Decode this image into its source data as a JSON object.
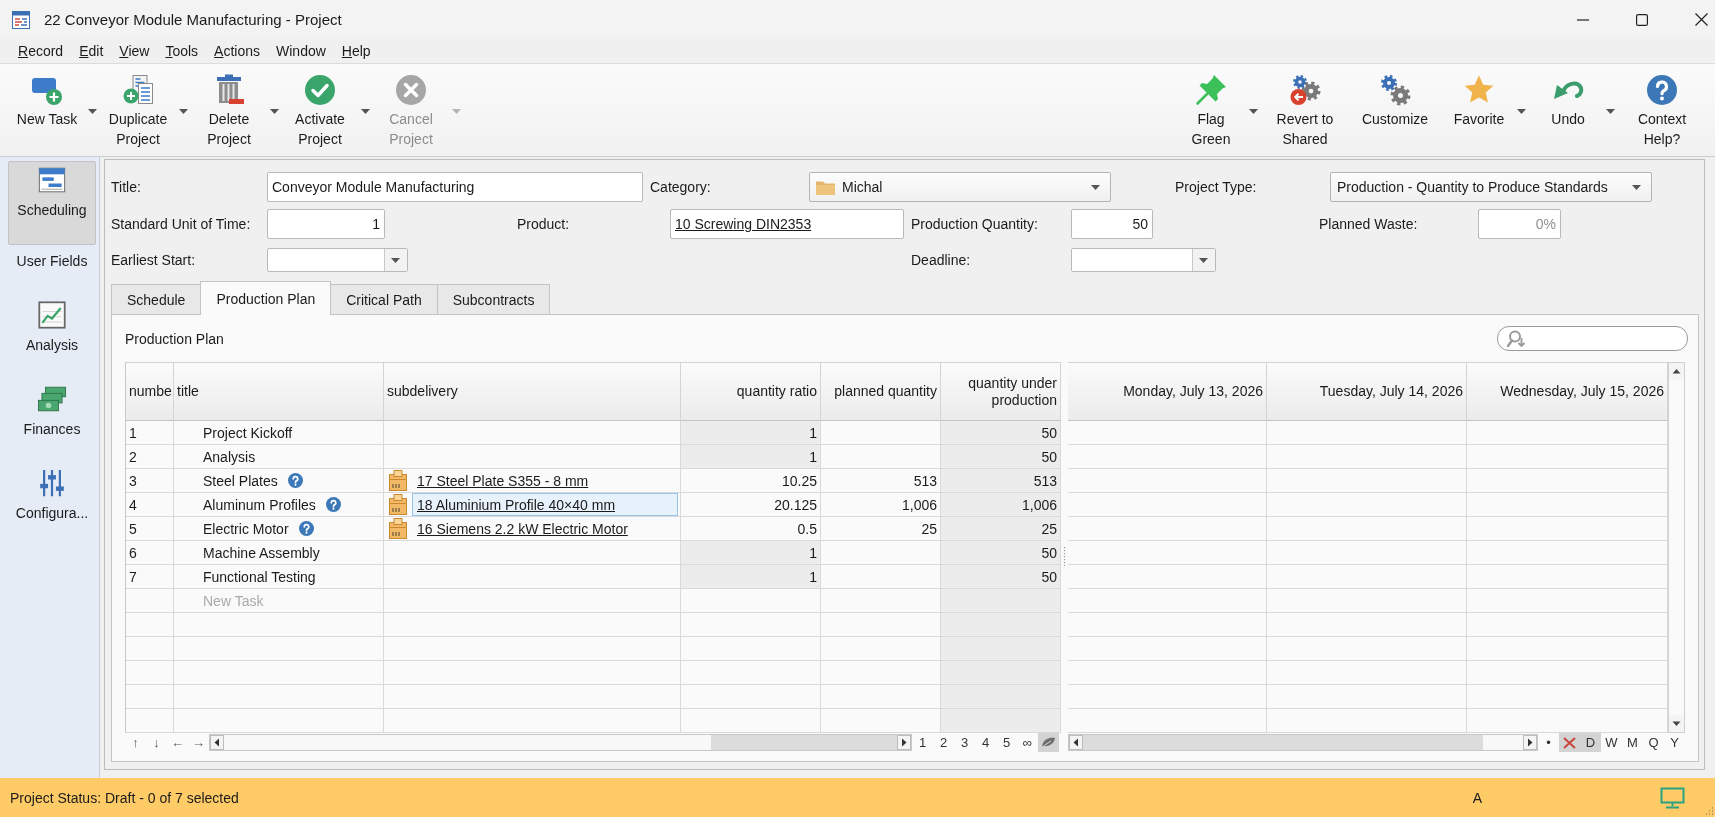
{
  "window": {
    "title": "22 Conveyor Module Manufacturing - Project"
  },
  "menu_bar": [
    {
      "label": "Record",
      "underlined_initial": true
    },
    {
      "label": "Edit",
      "underlined_initial": true
    },
    {
      "label": "View",
      "underlined_initial": true
    },
    {
      "label": "Tools",
      "underlined_initial": true
    },
    {
      "label": "Actions",
      "underlined_initial": true
    },
    {
      "label": "Window",
      "underlined_initial": false
    },
    {
      "label": "Help",
      "underlined_initial": true
    }
  ],
  "toolbar": {
    "left": [
      {
        "kind": "add",
        "lines": [
          "New Task"
        ],
        "dropdown": true,
        "disabled": false
      },
      {
        "kind": "duplicate",
        "lines": [
          "Duplicate",
          "Project"
        ],
        "dropdown": true,
        "disabled": false
      },
      {
        "kind": "delete",
        "lines": [
          "Delete",
          "Project"
        ],
        "dropdown": true,
        "disabled": false
      },
      {
        "kind": "activate",
        "lines": [
          "Activate",
          "Project"
        ],
        "dropdown": true,
        "disabled": false
      },
      {
        "kind": "cancel",
        "lines": [
          "Cancel",
          "Project"
        ],
        "dropdown": true,
        "disabled": true
      }
    ],
    "right": [
      {
        "kind": "pin",
        "lines": [
          "Flag",
          "Green"
        ],
        "dropdown": true,
        "disabled": false
      },
      {
        "kind": "revert",
        "lines": [
          "Revert to",
          "Shared"
        ],
        "dropdown": false,
        "disabled": false
      },
      {
        "kind": "customize",
        "lines": [
          "Customize"
        ],
        "dropdown": false,
        "disabled": false
      },
      {
        "kind": "favorite",
        "lines": [
          "Favorite"
        ],
        "dropdown": true,
        "disabled": false
      },
      {
        "kind": "undo",
        "lines": [
          "Undo"
        ],
        "dropdown": true,
        "disabled": false
      },
      {
        "kind": "help",
        "lines": [
          "Context",
          "Help?"
        ],
        "dropdown": false,
        "disabled": false
      }
    ]
  },
  "sidebar": {
    "items": [
      {
        "kind": "scheduling",
        "label": "Scheduling",
        "selected": true
      },
      {
        "kind": "fields",
        "label": "User Fields",
        "selected": false
      },
      {
        "kind": "analysis",
        "label": "Analysis",
        "selected": false
      },
      {
        "kind": "finances",
        "label": "Finances",
        "selected": false
      },
      {
        "kind": "configuration",
        "label": "Configura...",
        "selected": false
      }
    ]
  },
  "form": {
    "title": {
      "label": "Title:",
      "value": "Conveyor Module Manufacturing"
    },
    "category": {
      "label": "Category:",
      "value": "Michal"
    },
    "project_type": {
      "label": "Project Type:",
      "value": "Production - Quantity to Produce Standards"
    },
    "standard_unit_of_time": {
      "label": "Standard Unit of Time:",
      "value": "1"
    },
    "product": {
      "label": "Product:",
      "value": "10 Screwing DIN2353"
    },
    "production_quantity": {
      "label": "Production Quantity:",
      "value": "50"
    },
    "planned_waste": {
      "label": "Planned Waste:",
      "value": "0%",
      "disabled": true
    },
    "earliest_start": {
      "label": "Earliest Start:"
    },
    "deadline": {
      "label": "Deadline:"
    }
  },
  "tabs": [
    {
      "label": "Schedule",
      "selected": false
    },
    {
      "label": "Production Plan",
      "selected": true
    },
    {
      "label": "Critical Path",
      "selected": false
    },
    {
      "label": "Subcontracts",
      "selected": false
    }
  ],
  "production_plan": {
    "heading": "Production Plan",
    "table": {
      "columns": [
        "numbe",
        "title",
        "subdelivery",
        "quantity ratio",
        "planned quantity",
        "quantity under production"
      ],
      "rows": [
        {
          "number": "1",
          "title": "Project Kickoff",
          "kind": "task",
          "ratio": "1",
          "ratio_editable": false,
          "under_production": "50"
        },
        {
          "number": "2",
          "title": "Analysis",
          "kind": "task",
          "ratio": "1",
          "ratio_editable": false,
          "under_production": "50"
        },
        {
          "number": "3",
          "title": "Steel Plates",
          "kind": "material",
          "subdelivery": {
            "label": "17 Steel Plate S355 - 8 mm",
            "selected": false
          },
          "ratio": "10.25",
          "ratio_editable": true,
          "planned_quantity": "513",
          "under_production": "513"
        },
        {
          "number": "4",
          "title": "Aluminum Profiles",
          "kind": "material",
          "subdelivery": {
            "label": "18 Aluminium Profile 40×40 mm",
            "selected": true
          },
          "ratio": "20.125",
          "ratio_editable": true,
          "planned_quantity": "1,006",
          "under_production": "1,006"
        },
        {
          "number": "5",
          "title": "Electric Motor",
          "kind": "material",
          "subdelivery": {
            "label": "16 Siemens 2.2 kW Electric Motor",
            "selected": false
          },
          "ratio": "0.5",
          "ratio_editable": true,
          "planned_quantity": "25",
          "under_production": "25"
        },
        {
          "number": "6",
          "title": "Machine Assembly",
          "kind": "task",
          "ratio": "1",
          "ratio_editable": false,
          "under_production": "50"
        },
        {
          "number": "7",
          "title": "Functional Testing",
          "kind": "task",
          "ratio": "1",
          "ratio_editable": false,
          "under_production": "50"
        }
      ],
      "new_row_placeholder": "New Task"
    },
    "timeline": {
      "columns": [
        "Monday, July 13, 2026",
        "Tuesday, July 14, 2026",
        "Wednesday, July 15, 2026"
      ]
    },
    "table_footer": {
      "nav_arrows": [
        "↑",
        "↓",
        "←",
        "→"
      ],
      "levels": [
        {
          "kind": "text",
          "label": "1",
          "selected": false
        },
        {
          "kind": "text",
          "label": "2",
          "selected": false
        },
        {
          "kind": "text",
          "label": "3",
          "selected": false
        },
        {
          "kind": "text",
          "label": "4",
          "selected": false
        },
        {
          "kind": "text",
          "label": "5",
          "selected": false
        },
        {
          "kind": "text",
          "label": "∞",
          "selected": false
        },
        {
          "kind": "icon",
          "selected": true
        }
      ]
    },
    "timeline_footer": {
      "scales": [
        {
          "kind": "text",
          "label": "•",
          "selected": false
        },
        {
          "kind": "icon",
          "selected": true
        },
        {
          "kind": "text",
          "label": "D",
          "selected": true
        },
        {
          "kind": "text",
          "label": "W",
          "selected": false
        },
        {
          "kind": "text",
          "label": "M",
          "selected": false
        },
        {
          "kind": "text",
          "label": "Q",
          "selected": false
        },
        {
          "kind": "text",
          "label": "Y",
          "selected": false
        }
      ]
    }
  },
  "status_bar": {
    "text": "Project Status: Draft - 0 of 7 selected",
    "indicator": "A"
  }
}
